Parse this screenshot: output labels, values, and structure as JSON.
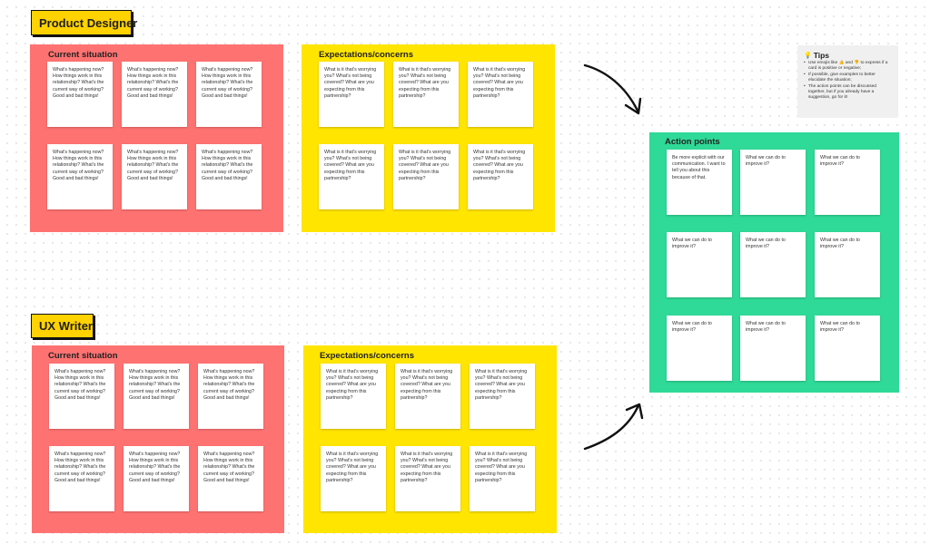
{
  "sections": [
    {
      "label": "Product Designer",
      "current": {
        "title": "Current situation",
        "cards": [
          "What's happening now? How things work in this relationship? What's the current way of working? Good and bad things!",
          "What's happening now? How things work in this relationship? What's the current way of working? Good and bad things!",
          "What's happening now? How things work in this relationship? What's the current way of working? Good and bad things!",
          "What's happening now? How things work in this relationship? What's the current way of working? Good and bad things!",
          "What's happening now? How things work in this relationship? What's the current way of working? Good and bad things!",
          "What's happening now? How things work in this relationship? What's the current way of working? Good and bad things!"
        ]
      },
      "expectations": {
        "title": "Expectations/concerns",
        "cards": [
          "What is it that's worrying you? What's not being covered? What are you expecting from this partnership?",
          "What is it that's worrying you? What's not being covered? What are you expecting from this partnership?",
          "What is it that's worrying you? What's not being covered? What are you expecting from this partnership?",
          "What is it that's worrying you? What's not being covered? What are you expecting from this partnership?",
          "What is it that's worrying you? What's not being covered? What are you expecting from this partnership?",
          "What is it that's worrying you? What's not being covered? What are you expecting from this partnership?"
        ]
      }
    },
    {
      "label": "UX Writer",
      "current": {
        "title": "Current situation",
        "cards": [
          "What's happening now? How things work in this relationship? What's the current way of working? Good and bad things!",
          "What's happening now? How things work in this relationship? What's the current way of working? Good and bad things!",
          "What's happening now? How things work in this relationship? What's the current way of working? Good and bad things!",
          "What's happening now? How things work in this relationship? What's the current way of working? Good and bad things!",
          "What's happening now? How things work in this relationship? What's the current way of working? Good and bad things!",
          "What's happening now? How things work in this relationship? What's the current way of working? Good and bad things!"
        ]
      },
      "expectations": {
        "title": "Expectations/concerns",
        "cards": [
          "What is it that's worrying you? What's not being covered? What are you expecting from this partnership?",
          "What is it that's worrying you? What's not being covered? What are you expecting from this partnership?",
          "What is it that's worrying you? What's not being covered? What are you expecting from this partnership?",
          "What is it that's worrying you? What's not being covered? What are you expecting from this partnership?",
          "What is it that's worrying you? What's not being covered? What are you expecting from this partnership?",
          "What is it that's worrying you? What's not being covered? What are you expecting from this partnership?"
        ]
      }
    }
  ],
  "action_points": {
    "title": "Action points",
    "cards": [
      "Be more explicit with our communication. I want to tell you about this because of that.",
      "What we can do to improve it?",
      "What we can do to improve it?",
      "What we can do to improve it?",
      "What we can do to improve it?",
      "What we can do to improve it?",
      "What we can do to improve it?",
      "What we can do to improve it?",
      "What we can do to improve it?"
    ]
  },
  "tips": {
    "icon": "💡",
    "title": "Tips",
    "items": [
      "Use emojis like 👍 and 👎 to express if a card is positive or negative;",
      "If possible, give examples to better elucidate the situation;",
      "The action points can be discussed together, but if you already have a suggestion, go for it!"
    ]
  },
  "colors": {
    "current_frame": "#ff7272",
    "expectations_frame": "#ffe500",
    "action_frame": "#2fd997",
    "label_box": "#ffd200"
  }
}
